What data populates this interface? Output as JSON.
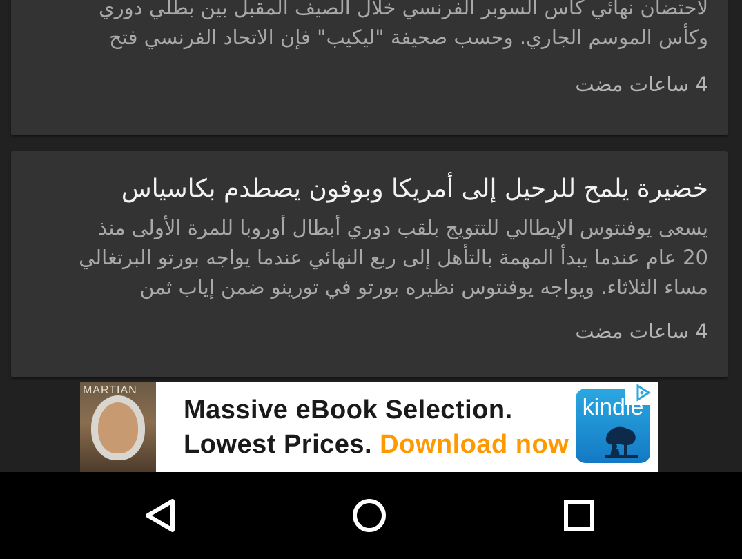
{
  "cards": [
    {
      "body_lines": [
        "لاحتضان نهائي كأس السوبر الفرنسي خلال الصيف المقبل بين بطلي دوري",
        "وكأس الموسم الجاري. وحسب صحيفة \"ليكيب\" فإن الاتحاد الفرنسي فتح"
      ],
      "time": "4 ساعات مضت"
    },
    {
      "title": "خضيرة يلمح للرحيل إلى أمريكا وبوفون يصطدم بكاسياس",
      "body_lines": [
        "يسعى يوفنتوس الإيطالي للتتويج بلقب دوري أبطال أوروبا للمرة الأولى منذ",
        "20 عام عندما يبدأ المهمة بالتأهل إلى ربع النهائي عندما يواجه بورتو البرتغالي",
        "مساء الثلاثاء. ويواجه يوفنتوس نظيره بورتو في تورينو ضمن إياب ثمن"
      ],
      "time": "4 ساعات مضت"
    }
  ],
  "ad": {
    "cover_title": "MARTIAN",
    "line1": "Massive eBook Selection.",
    "line2_prefix": "Lowest Prices. ",
    "line2_cta": "Download now",
    "brand": "kindle",
    "cta_color": "#ff9900"
  },
  "navbar": {
    "back_icon": "back-triangle-icon",
    "home_icon": "home-circle-icon",
    "recent_icon": "recents-square-icon"
  }
}
